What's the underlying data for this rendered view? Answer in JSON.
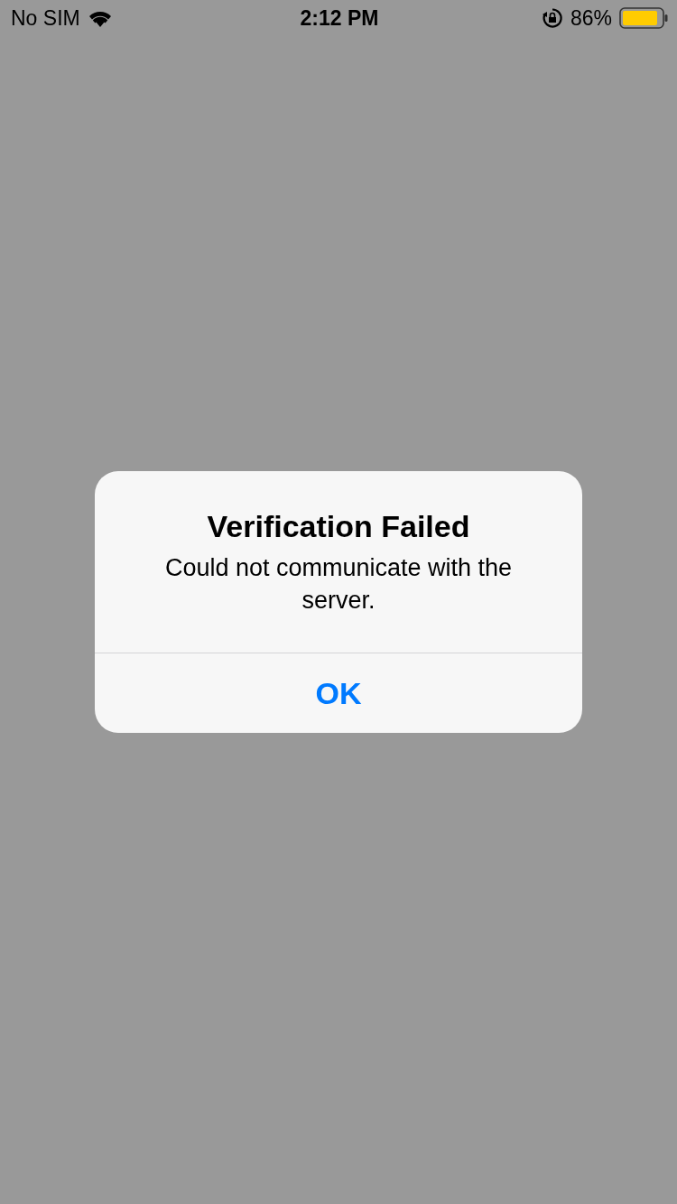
{
  "status_bar": {
    "carrier": "No SIM",
    "time": "2:12 PM",
    "battery": "86%"
  },
  "alert": {
    "title": "Verification Failed",
    "message": "Could not communicate with the server.",
    "buttons": [
      "OK"
    ]
  }
}
